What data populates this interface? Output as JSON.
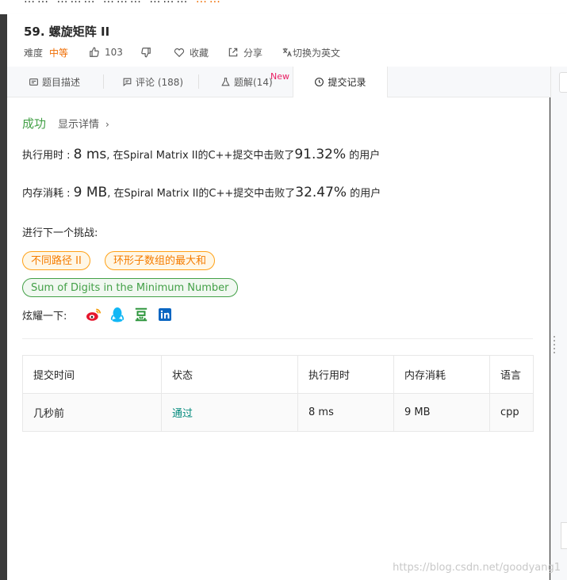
{
  "problem": {
    "title": "59. 螺旋矩阵 II",
    "difficulty_label": "难度",
    "difficulty_value": "中等",
    "likes": "103",
    "favorite_label": "收藏",
    "share_label": "分享",
    "translate_label": "切换为英文"
  },
  "tabs": [
    {
      "label": "题目描述",
      "icon": "doc-icon"
    },
    {
      "label": "评论 (188)",
      "icon": "comment-icon"
    },
    {
      "label": "题解(14)",
      "icon": "flask-icon",
      "badge": "New"
    },
    {
      "label": "提交记录",
      "icon": "clock-icon",
      "active": true
    }
  ],
  "result": {
    "status": "成功",
    "details_label": "显示详情",
    "runtime": {
      "label": "执行用时 : ",
      "value": "8 ms",
      "middle": ", 在Spiral Matrix II的C++提交中击败了",
      "percent": "91.32%",
      "suffix": " 的用户"
    },
    "memory": {
      "label": "内存消耗 : ",
      "value": "9 MB",
      "middle": ", 在Spiral Matrix II的C++提交中击败了",
      "percent": "32.47%",
      "suffix": " 的用户"
    }
  },
  "challenge": {
    "label": "进行下一个挑战:",
    "tags": [
      "不同路径 II",
      "环形子数组的最大和",
      "Sum of Digits in the Minimum Number"
    ]
  },
  "share": {
    "label": "炫耀一下:",
    "icons": [
      "weibo-icon",
      "qq-icon",
      "douban-icon",
      "linkedin-icon"
    ]
  },
  "table": {
    "headers": [
      "提交时间",
      "状态",
      "执行用时",
      "内存消耗",
      "语言"
    ],
    "rows": [
      [
        "几秒前",
        "通过",
        "8 ms",
        "9 MB",
        "cpp"
      ]
    ]
  },
  "watermark": "https://blog.csdn.net/goodyang1",
  "colors": {
    "accent_orange": "#ef6c00",
    "success_green": "#43a047",
    "pass_teal": "#00897b",
    "new_badge": "#e91e63"
  }
}
